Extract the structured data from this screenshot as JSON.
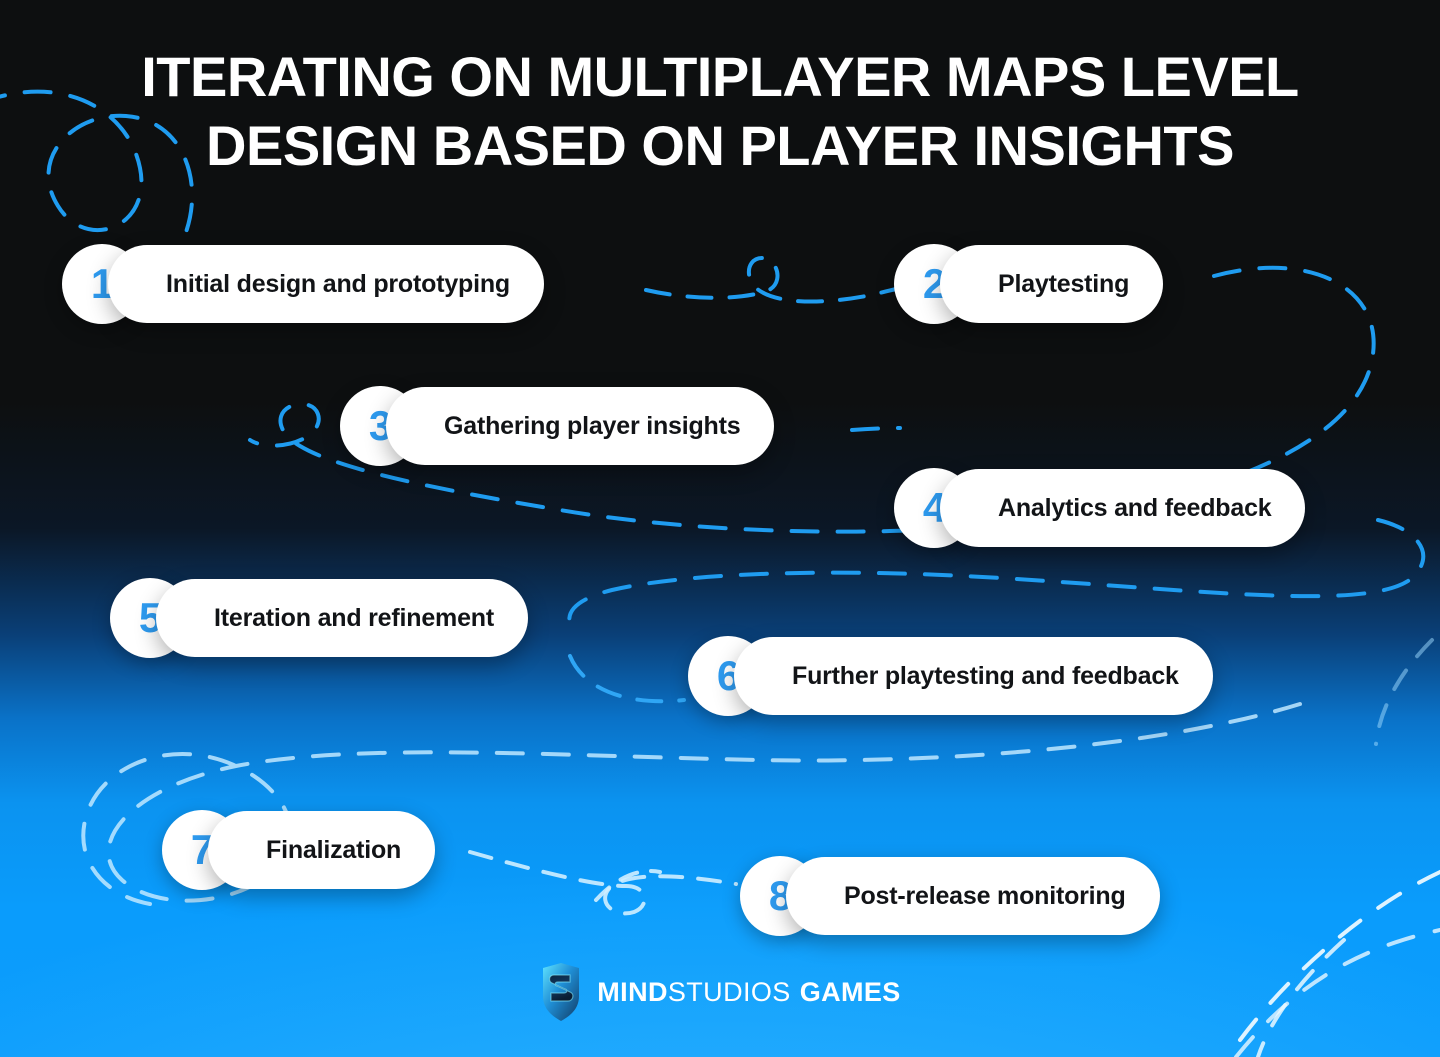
{
  "title": {
    "line1": "ITERATING ON MULTIPLAYER MAPS LEVEL",
    "line2": "DESIGN BASED ON PLAYER INSIGHTS"
  },
  "colors": {
    "number_blue": "#2e9bf0",
    "pill_bg": "#ffffff",
    "pill_text": "#121417",
    "bg_top": "#0d0f10",
    "bg_bottom": "#0a9cfc",
    "dash_blue": "#1f9cf0",
    "dash_light": "#bfe8ff"
  },
  "steps": [
    {
      "number": "1",
      "label": "Initial design and prototyping"
    },
    {
      "number": "2",
      "label": "Playtesting"
    },
    {
      "number": "3",
      "label": "Gathering player insights"
    },
    {
      "number": "4",
      "label": "Analytics and feedback"
    },
    {
      "number": "5",
      "label": "Iteration and refinement"
    },
    {
      "number": "6",
      "label": "Further playtesting and feedback"
    },
    {
      "number": "7",
      "label": "Finalization"
    },
    {
      "number": "8",
      "label": "Post-release monitoring"
    }
  ],
  "logo": {
    "icon": "shield-s-icon",
    "word_bold_1": "MIND",
    "word_light": "STUDIOS",
    "word_bold_2": "GAMES"
  }
}
